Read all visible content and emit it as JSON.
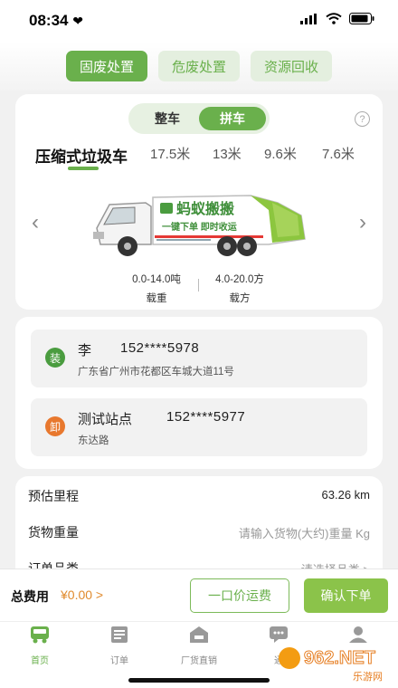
{
  "status": {
    "time": "08:34"
  },
  "top_tabs": [
    {
      "label": "固废处置",
      "active": true
    },
    {
      "label": "危废处置",
      "active": false
    },
    {
      "label": "资源回收",
      "active": false
    }
  ],
  "vehicle_mode": {
    "options": [
      "整车",
      "拼车"
    ],
    "selected": "拼车"
  },
  "vehicle_tabs": [
    "压缩式垃圾车",
    "17.5米",
    "13米",
    "9.6米",
    "7.6米"
  ],
  "vehicle_image_text": {
    "brand": "蚂蚁搬搬",
    "slogan": "一键下单 即时收运"
  },
  "vehicle_specs": [
    {
      "value": "0.0-14.0吨",
      "label": "载重"
    },
    {
      "value": "4.0-20.0方",
      "label": "载方"
    }
  ],
  "addresses": [
    {
      "badge": "装",
      "name": "李",
      "phone": "152****5978",
      "address": "广东省广州市花都区车城大道11号",
      "badge_color": "#4a9c3f"
    },
    {
      "badge": "卸",
      "name": "测试站点",
      "phone": "152****5977",
      "address": "东达路",
      "badge_color": "#e8782e"
    }
  ],
  "order_fields": [
    {
      "label": "预估里程",
      "value": "63.26 km",
      "placeholder": false
    },
    {
      "label": "货物重量",
      "value": "请输入货物(大约)重量 Kg",
      "placeholder": true
    },
    {
      "label": "订单品类",
      "value": "请选择品类 >",
      "placeholder": true
    }
  ],
  "footer": {
    "total_label": "总费用",
    "total_value": "¥0.00 >",
    "fixed_price_button": "一口价运费",
    "confirm_button": "确认下单"
  },
  "bottom_nav": [
    {
      "label": "首页",
      "icon": "truck-icon",
      "active": true
    },
    {
      "label": "订单",
      "icon": "orders-icon",
      "active": false
    },
    {
      "label": "厂货直销",
      "icon": "factory-icon",
      "active": false
    },
    {
      "label": "通",
      "icon": "chat-icon",
      "active": false
    },
    {
      "label": "",
      "icon": "profile-icon",
      "active": false
    }
  ],
  "watermark": {
    "text": "962.NET",
    "sub": "乐游网"
  },
  "colors": {
    "accent": "#6ab04c",
    "accent_light": "#e4efdf",
    "price": "#e08a2d"
  }
}
